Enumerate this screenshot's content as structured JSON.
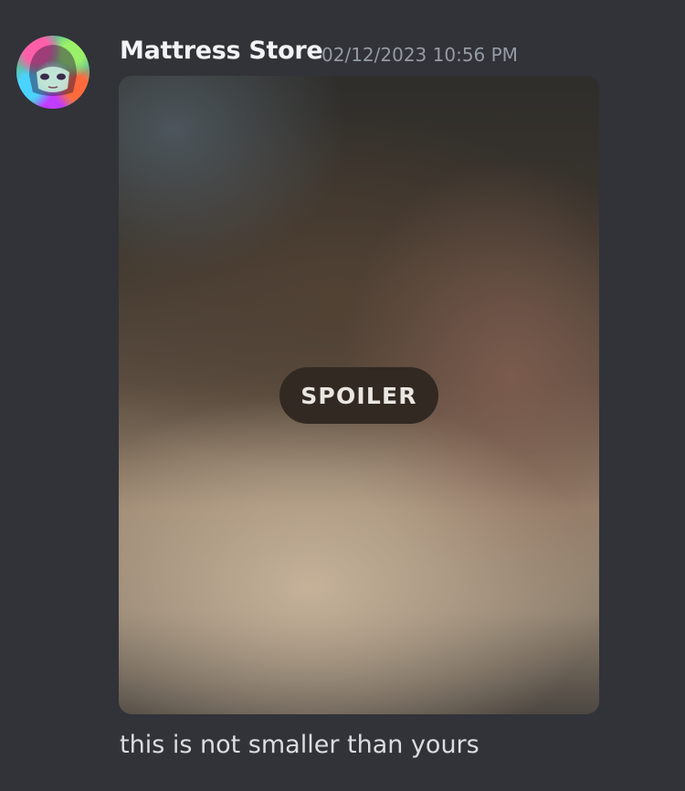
{
  "message": {
    "author": "Mattress Store",
    "timestamp": "02/12/2023 10:56 PM",
    "avatar_icon": "user-avatar-icon",
    "attachment": {
      "spoiler_label": "SPOILER"
    },
    "text": "this is not smaller than yours"
  },
  "colors": {
    "background": "#313338",
    "username": "#f2f3f5",
    "timestamp": "#949ba4",
    "text": "#dbdee1",
    "spoiler_pill": "#322923"
  }
}
